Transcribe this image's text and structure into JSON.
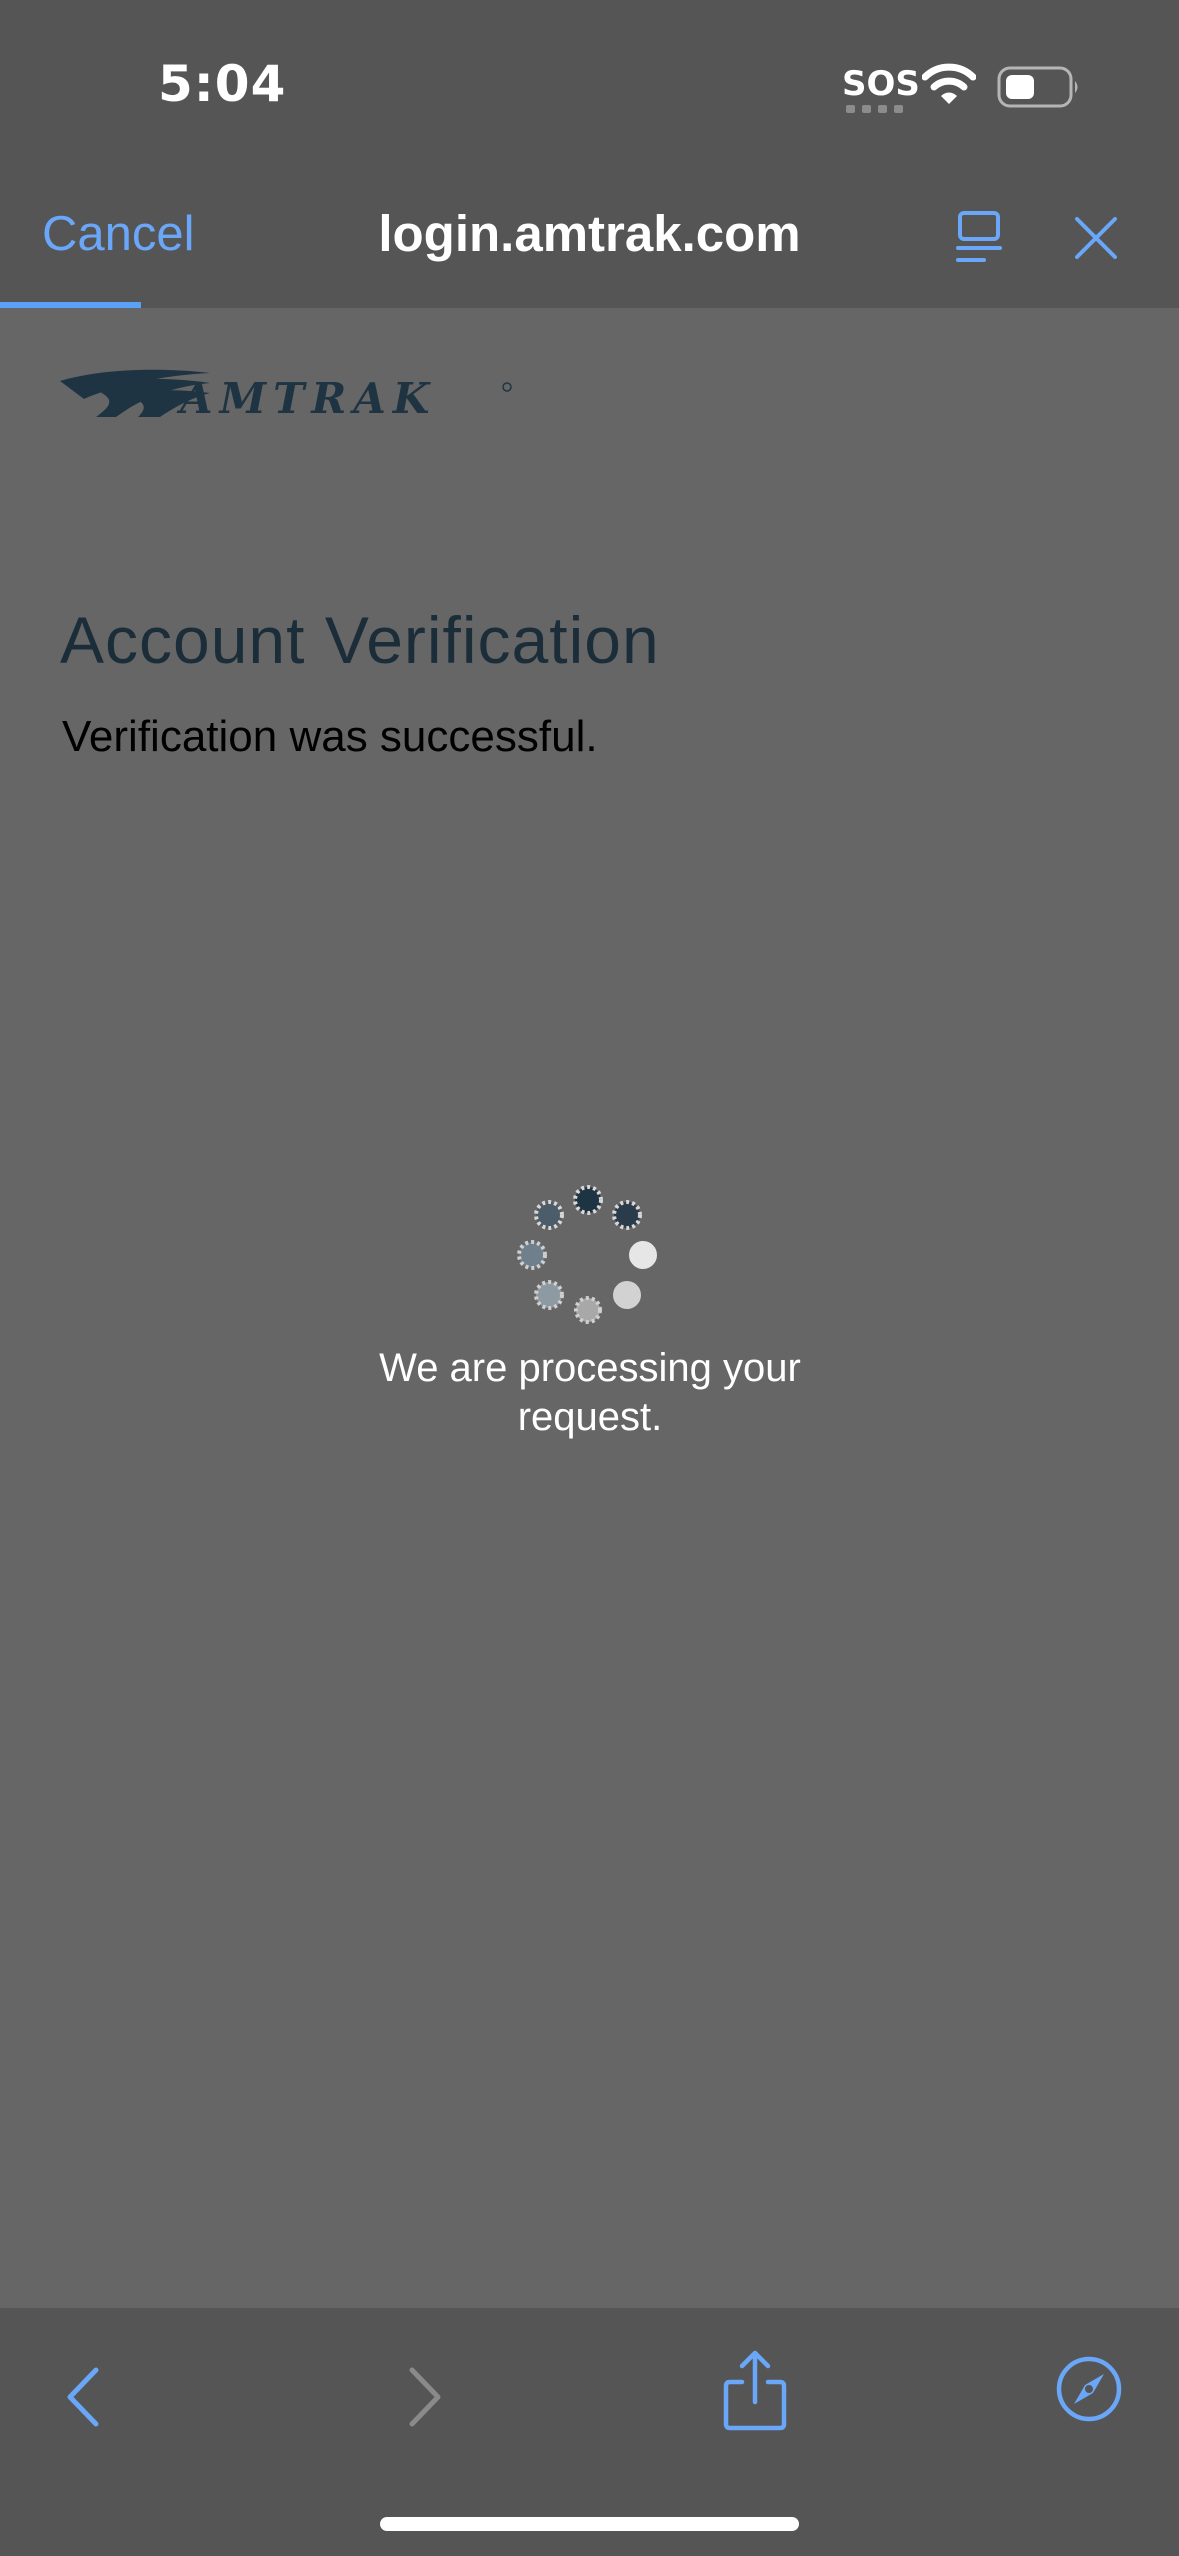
{
  "status_bar": {
    "time": "5:04",
    "carrier": "SOS",
    "icons": [
      "wifi-icon",
      "battery-icon"
    ]
  },
  "nav": {
    "cancel_label": "Cancel",
    "host": "login.amtrak.com",
    "icons": [
      "reader-icon",
      "close-icon"
    ]
  },
  "page": {
    "logo_text": "AMTRAK",
    "title": "Account Verification",
    "message": "Verification was successful.",
    "processing_text": "We are processing your request."
  },
  "toolbar": {
    "icons": [
      "back-icon",
      "forward-icon",
      "share-icon",
      "compass-icon"
    ]
  },
  "colors": {
    "accent": "#6aa7f8",
    "chrome_bg": "#555555",
    "page_bg": "#666666",
    "title": "#1c2d3a"
  }
}
